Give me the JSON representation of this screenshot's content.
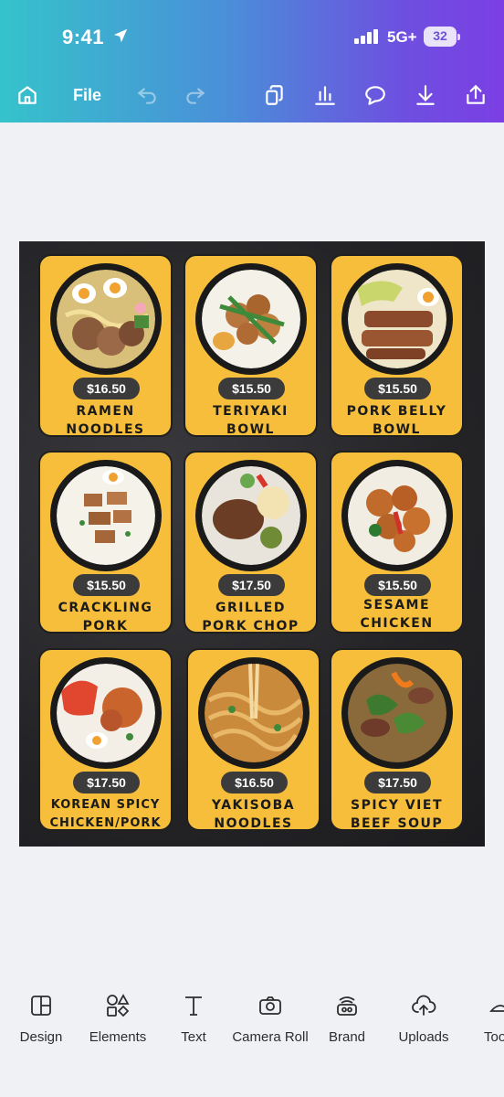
{
  "status_bar": {
    "time": "9:41",
    "network": "5G+",
    "battery": "32"
  },
  "toolbar": {
    "file_label": "File"
  },
  "menu": {
    "items": [
      {
        "name": "RAMEN",
        "name2": "NOODLES",
        "price": "$16.50"
      },
      {
        "name": "TERIYAKI",
        "name2": "BOWL",
        "price": "$15.50"
      },
      {
        "name": "PORK BELLY",
        "name2": "BOWL",
        "price": "$15.50"
      },
      {
        "name": "CRACKLING",
        "name2": "PORK",
        "price": "$15.50"
      },
      {
        "name": "GRILLED",
        "name2": "PORK CHOP",
        "price": "$17.50"
      },
      {
        "name": "SESAME",
        "name2": "CHICKEN",
        "price": "$15.50"
      },
      {
        "name": "KOREAN SPICY",
        "name2": "CHICKEN/PORK",
        "price": "$17.50"
      },
      {
        "name": "YAKISOBA",
        "name2": "NOODLES",
        "price": "$16.50"
      },
      {
        "name": "SPICY VIET",
        "name2": "BEEF SOUP",
        "price": "$17.50"
      }
    ]
  },
  "bottom_nav": {
    "items": [
      {
        "label": "Design",
        "icon": "design-icon"
      },
      {
        "label": "Elements",
        "icon": "elements-icon"
      },
      {
        "label": "Text",
        "icon": "text-icon"
      },
      {
        "label": "Camera Roll",
        "icon": "camera-icon"
      },
      {
        "label": "Brand",
        "icon": "brand-icon"
      },
      {
        "label": "Uploads",
        "icon": "uploads-icon"
      },
      {
        "label": "Too",
        "icon": "tools-icon"
      }
    ]
  },
  "colors": {
    "card": "#f6be3b",
    "price_badge": "#3b3b3b",
    "header_start": "#35c3cb",
    "header_end": "#7b3fe4"
  }
}
